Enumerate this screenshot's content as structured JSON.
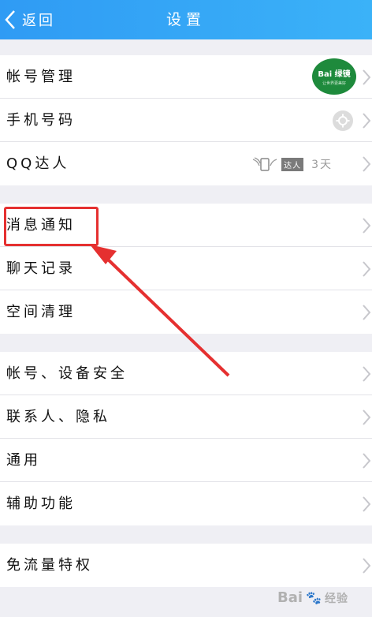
{
  "header": {
    "back_label": "返回",
    "title": "设置"
  },
  "groups": [
    {
      "items": [
        {
          "label": "帐号管理",
          "extra": "avatar",
          "avatar_text": "Bai 绿镜",
          "avatar_sub": "让世界更美好"
        },
        {
          "label": "手机号码",
          "extra": "gear-icon"
        },
        {
          "label": "QQ达人",
          "extra": "qq-badge",
          "badge_text": "达人",
          "days_text": "3天"
        }
      ]
    },
    {
      "items": [
        {
          "label": "消息通知",
          "highlighted": true
        },
        {
          "label": "聊天记录"
        },
        {
          "label": "空间清理"
        }
      ]
    },
    {
      "items": [
        {
          "label": "帐号、设备安全"
        },
        {
          "label": "联系人、隐私"
        },
        {
          "label": "通用"
        },
        {
          "label": "辅助功能"
        }
      ]
    },
    {
      "items": [
        {
          "label": "免流量特权"
        }
      ]
    }
  ],
  "watermark": {
    "text": "Bai",
    "text2": "经验"
  },
  "colors": {
    "header_start": "#2f9bf4",
    "header_end": "#3bb2f8",
    "annotation_red": "#e53030",
    "background": "#efeff4",
    "avatar_green": "#1e8a3c"
  }
}
